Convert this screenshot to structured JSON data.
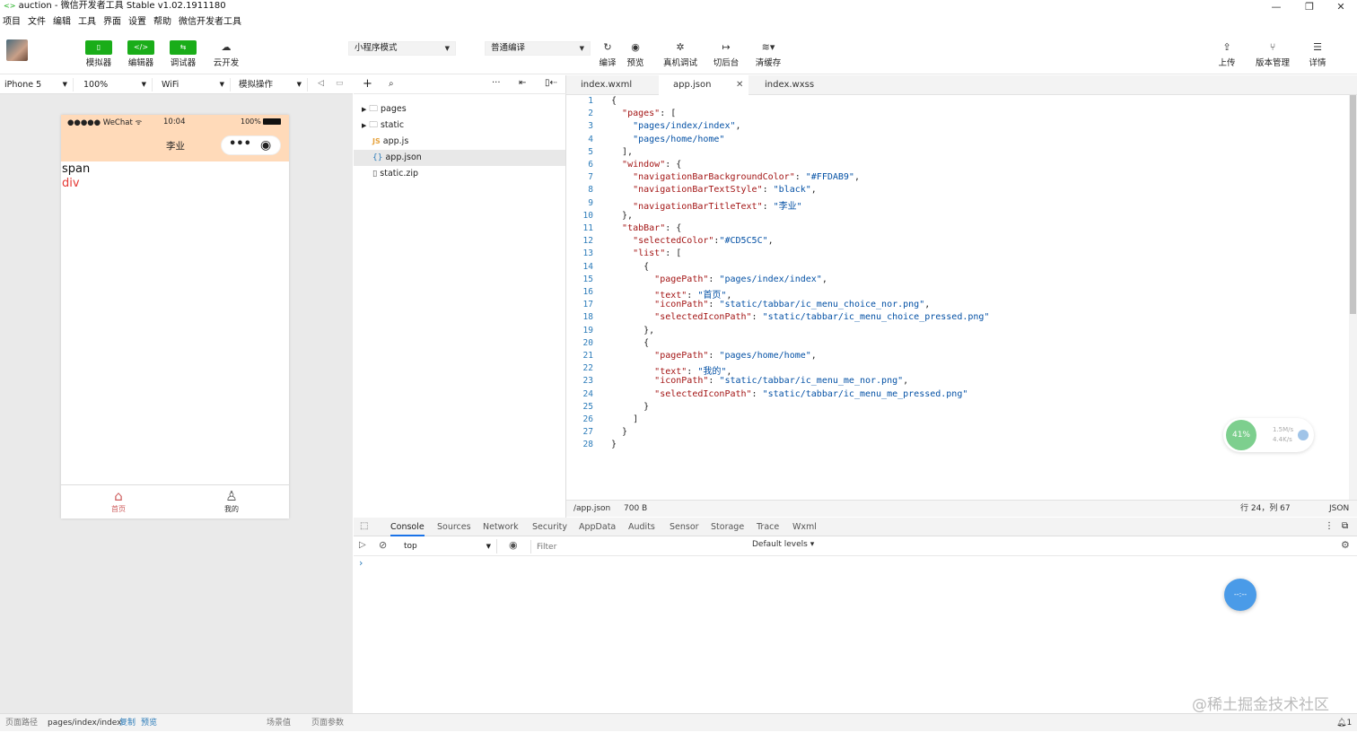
{
  "window": {
    "title": "auction - 微信开发者工具 Stable v1.02.1911180",
    "controls": [
      "—",
      "❐",
      "✕"
    ]
  },
  "menu": [
    "项目",
    "文件",
    "编辑",
    "工具",
    "界面",
    "设置",
    "帮助",
    "微信开发者工具"
  ],
  "toolbar": {
    "simulator": "模拟器",
    "editor": "编辑器",
    "debugger": "调试器",
    "cloud": "云开发",
    "mode_select": "小程序模式",
    "compile_select": "普通编译",
    "compile": "编译",
    "preview": "预览",
    "remote_debug": "真机调试",
    "background": "切后台",
    "clear_cache": "清缓存",
    "upload": "上传",
    "version": "版本管理",
    "detail": "详情"
  },
  "simbar": {
    "device": "iPhone 5",
    "zoom": "100%",
    "network": "WiFi",
    "operation": "模拟操作"
  },
  "phone": {
    "signal": "●●●●● WeChat",
    "time": "10:04",
    "battery": "100%",
    "nav_title": "李业",
    "nav_bg": "#FFDAB9",
    "body_span": "span",
    "body_div": "div",
    "tabbar": [
      {
        "label": "首页",
        "selected": true
      },
      {
        "label": "我的",
        "selected": false
      }
    ],
    "selected_color": "#CD5C5C"
  },
  "files": [
    {
      "name": "pages",
      "type": "folder"
    },
    {
      "name": "static",
      "type": "folder"
    },
    {
      "name": "app.js",
      "type": "js"
    },
    {
      "name": "app.json",
      "type": "json",
      "selected": true
    },
    {
      "name": "static.zip",
      "type": "file"
    }
  ],
  "tabs": [
    {
      "label": "index.wxml",
      "active": false
    },
    {
      "label": "app.json",
      "active": true
    },
    {
      "label": "index.wxss",
      "active": false
    }
  ],
  "code_lines": [
    "{",
    "  \"pages\": [",
    "    \"pages/index/index\",",
    "    \"pages/home/home\"",
    "  ],",
    "  \"window\": {",
    "    \"navigationBarBackgroundColor\": \"#FFDAB9\",",
    "    \"navigationBarTextStyle\": \"black\",",
    "    \"navigationBarTitleText\": \"李业\"",
    "  },",
    "  \"tabBar\": {",
    "    \"selectedColor\":\"#CD5C5C\",",
    "    \"list\": [",
    "      {",
    "        \"pagePath\": \"pages/index/index\",",
    "        \"text\": \"首页\",",
    "        \"iconPath\": \"static/tabbar/ic_menu_choice_nor.png\",",
    "        \"selectedIconPath\": \"static/tabbar/ic_menu_choice_pressed.png\"",
    "      },",
    "      {",
    "        \"pagePath\": \"pages/home/home\",",
    "        \"text\": \"我的\",",
    "        \"iconPath\": \"static/tabbar/ic_menu_me_nor.png\",",
    "        \"selectedIconPath\": \"static/tabbar/ic_menu_me_pressed.png\"",
    "      }",
    "    ]",
    "  }",
    "}"
  ],
  "status": {
    "path": "/app.json",
    "size": "700 B",
    "cursor": "行 24，列 67",
    "lang": "JSON"
  },
  "net_widget": {
    "percent": "41%",
    "up": "1.5M/s",
    "down": "4.4K/s"
  },
  "devtools": {
    "tabs": [
      "Console",
      "Sources",
      "Network",
      "Security",
      "AppData",
      "Audits",
      "Sensor",
      "Storage",
      "Trace",
      "Wxml"
    ],
    "active_tab": "Console",
    "context": "top",
    "filter_placeholder": "Filter",
    "levels": "Default levels ▾",
    "prompt": "›"
  },
  "watermark": "@稀土掘金技术社区",
  "bottom": {
    "path_label": "页面路径",
    "path": "pages/index/index",
    "copy": "复制",
    "preview": "预览",
    "scene": "场景值",
    "params": "页面参数",
    "notifications": "1"
  }
}
